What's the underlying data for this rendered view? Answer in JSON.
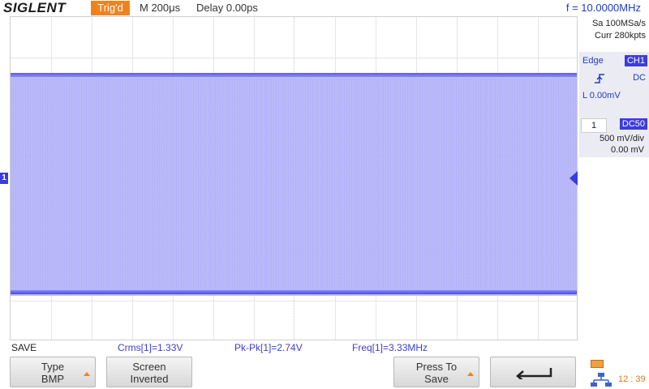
{
  "top": {
    "brand": "SIGLENT",
    "trig_status": "Trig'd",
    "timebase": "M 200μs",
    "delay": "Delay 0.00ps",
    "frequency": "f = 10.0000MHz"
  },
  "acquire": {
    "sample_rate": "Sa 100MSa/s",
    "memory": "Curr 280kpts"
  },
  "trigger": {
    "type": "Edge",
    "source": "CH1",
    "coupling": "DC",
    "level": "L  0.00mV",
    "slope_icon": "rising-edge-icon"
  },
  "channel": {
    "number": "1",
    "coupling": "DC50",
    "scale": "500 mV/div",
    "offset": "0.00 mV",
    "marker": "1",
    "color": "#3c3cdc"
  },
  "waveform": {
    "fill_color": "#b9b9f9"
  },
  "measurements": {
    "menu_title": "SAVE",
    "items": [
      "Crms[1]=1.33V",
      "Pk-Pk[1]=2.74V",
      "Freq[1]=3.33MHz"
    ]
  },
  "softkeys": [
    {
      "line1": "Type",
      "line2": "BMP"
    },
    {
      "line1": "Screen",
      "line2": "Inverted"
    },
    {
      "line1": "Press To",
      "line2": "Save"
    },
    {
      "icon": "back-arrow-icon"
    }
  ],
  "status": {
    "time": "12 : 39",
    "accent_color": "#f0821e"
  }
}
